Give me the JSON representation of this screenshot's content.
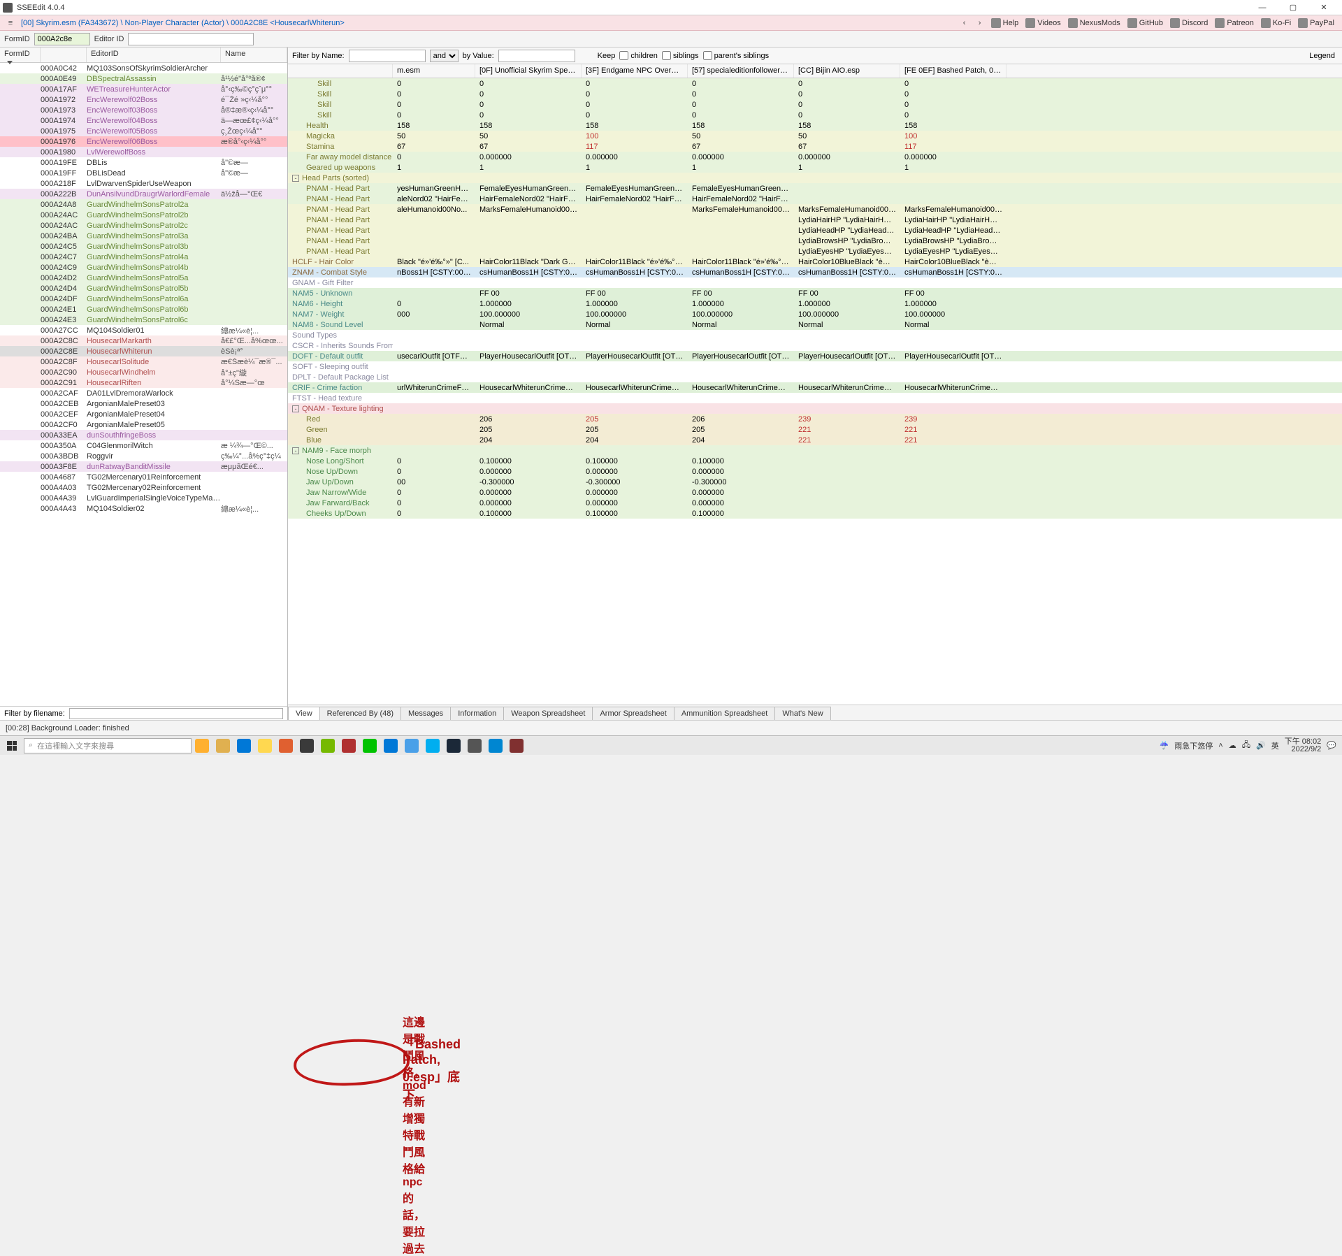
{
  "app": {
    "title": "SSEEdit 4.0.4"
  },
  "crumb": "[00] Skyrim.esm (FA343672) \\ Non-Player Character (Actor) \\ 000A2C8E <HousecarlWhiterun>",
  "toplinks": [
    "Help",
    "Videos",
    "NexusMods",
    "GitHub",
    "Discord",
    "Patreon",
    "Ko-Fi",
    "PayPal"
  ],
  "fidbar": {
    "formid_lbl": "FormID",
    "formid_val": "000A2c8e",
    "editorid_lbl": "Editor ID",
    "editorid_val": ""
  },
  "left_hdr": {
    "c1": "FormID",
    "c2": "",
    "c3": "EditorID",
    "c4": "Name"
  },
  "left_rows": [
    {
      "f": "000A0C42",
      "e": "MQ103SonsOfSkyrimSoldierArcher",
      "n": "",
      "cls": "c-plain"
    },
    {
      "f": "000A0E49",
      "e": "DBSpectralAssassin",
      "n": "å¹½é­\"å°ºå®¢",
      "cls": "c-green0"
    },
    {
      "f": "000A17AF",
      "e": "WETreasureHunterActor",
      "n": "å°‹ç‰©ç°çˆμ°°",
      "cls": "c-purple"
    },
    {
      "f": "000A1972",
      "e": "EncWerewolf02Boss",
      "n": "é¯Žé »ç‹¼å°°",
      "cls": "c-purple"
    },
    {
      "f": "000A1973",
      "e": "EncWerewolf03Boss",
      "n": "å®‡æ®‹ç‹¼å°°",
      "cls": "c-purple"
    },
    {
      "f": "000A1974",
      "e": "EncWerewolf04Boss",
      "n": "ä—æœ£¢ç‹¼å°°",
      "cls": "c-purple"
    },
    {
      "f": "000A1975",
      "e": "EncWerewolf05Boss",
      "n": "ç¸Žœç‹¼å°°",
      "cls": "c-purple"
    },
    {
      "f": "000A1976",
      "e": "EncWerewolf06Boss",
      "n": "æ®å°‹ç‹¼å°°",
      "cls": "c-purpleR hlbar"
    },
    {
      "f": "000A1980",
      "e": "LvlWerewolfBoss",
      "n": "",
      "cls": "c-purple"
    },
    {
      "f": "000A19FE",
      "e": "DBLis",
      "n": "å\"©æ—",
      "cls": "c-plain"
    },
    {
      "f": "000A19FF",
      "e": "DBLisDead",
      "n": "å\"©æ—",
      "cls": "c-plain"
    },
    {
      "f": "000A218F",
      "e": "LvlDwarvenSpiderUseWeapon",
      "n": "",
      "cls": "c-plain"
    },
    {
      "f": "000A222B",
      "e": "DunAnsilvundDraugrWarlordFemale",
      "n": "ä½žå—°Œ€",
      "cls": "c-purple"
    },
    {
      "f": "000A24A8",
      "e": "GuardWindhelmSonsPatrol2a",
      "n": "",
      "cls": "c-green0"
    },
    {
      "f": "000A24AC",
      "e": "GuardWindhelmSonsPatrol2b",
      "n": "",
      "cls": "c-green0"
    },
    {
      "f": "000A24AC",
      "e": "GuardWindhelmSonsPatrol2c",
      "n": "",
      "cls": "c-green0"
    },
    {
      "f": "000A24BA",
      "e": "GuardWindhelmSonsPatrol3a",
      "n": "",
      "cls": "c-green0"
    },
    {
      "f": "000A24C5",
      "e": "GuardWindhelmSonsPatrol3b",
      "n": "",
      "cls": "c-green0"
    },
    {
      "f": "000A24C7",
      "e": "GuardWindhelmSonsPatrol4a",
      "n": "",
      "cls": "c-green0"
    },
    {
      "f": "000A24C9",
      "e": "GuardWindhelmSonsPatrol4b",
      "n": "",
      "cls": "c-green0"
    },
    {
      "f": "000A24D2",
      "e": "GuardWindhelmSonsPatrol5a",
      "n": "",
      "cls": "c-green0"
    },
    {
      "f": "000A24D4",
      "e": "GuardWindhelmSonsPatrol5b",
      "n": "",
      "cls": "c-green0"
    },
    {
      "f": "000A24DF",
      "e": "GuardWindhelmSonsPatrol6a",
      "n": "",
      "cls": "c-green0"
    },
    {
      "f": "000A24E1",
      "e": "GuardWindhelmSonsPatrol6b",
      "n": "",
      "cls": "c-green0"
    },
    {
      "f": "000A24E3",
      "e": "GuardWindhelmSonsPatrol6c",
      "n": "",
      "cls": "c-green0"
    },
    {
      "f": "000A27CC",
      "e": "MQ104Soldier01",
      "n": "總æ¼«è¦...",
      "cls": "c-plain"
    },
    {
      "f": "000A2C8C",
      "e": "HousecarlMarkarth",
      "n": "å€£°Œ...å%œœ...",
      "cls": "c-red"
    },
    {
      "f": "000A2C8E",
      "e": "HousecarlWhiterun",
      "n": "èSè¡ª°",
      "cls": "c-red sel"
    },
    {
      "f": "000A2C8F",
      "e": "HousecarlSolitude",
      "n": "æ€Šæè¼¯æ®¯...",
      "cls": "c-red"
    },
    {
      "f": "000A2C90",
      "e": "HousecarlWindhelm",
      "n": "å°±ç\"縼",
      "cls": "c-red"
    },
    {
      "f": "000A2C91",
      "e": "HousecarlRiften",
      "n": "å°¼Sæ—°œ",
      "cls": "c-red"
    },
    {
      "f": "000A2CAF",
      "e": "DA01LvlDremoraWarlock",
      "n": "",
      "cls": "c-plain"
    },
    {
      "f": "000A2CEB",
      "e": "ArgonianMalePreset03",
      "n": "",
      "cls": "c-plain"
    },
    {
      "f": "000A2CEF",
      "e": "ArgonianMalePreset04",
      "n": "",
      "cls": "c-plain"
    },
    {
      "f": "000A2CF0",
      "e": "ArgonianMalePreset05",
      "n": "",
      "cls": "c-plain"
    },
    {
      "f": "000A33EA",
      "e": "dunSouthfringeBoss",
      "n": "",
      "cls": "c-purple"
    },
    {
      "f": "000A350A",
      "e": "C04GlenmorilWitch",
      "n": "æ ¼¾—°Œ©...",
      "cls": "c-plain"
    },
    {
      "f": "000A3BDB",
      "e": "Roggvir",
      "n": "ç‰¼°...å%ç°‡ç¼",
      "cls": "c-plain"
    },
    {
      "f": "000A3F8E",
      "e": "dunRatwayBanditMissile",
      "n": "æμμãŒé€...",
      "cls": "c-purple"
    },
    {
      "f": "000A4687",
      "e": "TG02Mercenary01Reinforcement",
      "n": "",
      "cls": "c-plain"
    },
    {
      "f": "000A4A03",
      "e": "TG02Mercenary02Reinforcement",
      "n": "",
      "cls": "c-plain"
    },
    {
      "f": "000A4A39",
      "e": "LvlGuardImperialSingleVoiceTypeMaleGuard",
      "n": "",
      "cls": "c-plain"
    },
    {
      "f": "000A4A43",
      "e": "MQ104Soldier02",
      "n": "總æ¼«è¦...",
      "cls": "c-plain"
    }
  ],
  "lfilter_lbl": "Filter by filename:",
  "rfilter": {
    "name_lbl": "Filter by Name:",
    "and": "and",
    "val_lbl": "by Value:",
    "keep": "Keep",
    "children": "children",
    "siblings": "siblings",
    "psib": "parent's siblings",
    "legend": "Legend"
  },
  "rhdr": [
    "",
    "m.esm",
    "[0F] Unofficial Skyrim Special E...",
    "[3F] Endgame NPC Overhaul.esp",
    "[57] specialeditionfollowers.esp",
    "[CC] Bijin AIO.esp",
    "[FE 0EF] Bashed Patch, 0.esp"
  ],
  "rrows": [
    {
      "n": "Skill",
      "i": 2,
      "bg": "bg-lg",
      "nc": "name-olive",
      "v": [
        "0",
        "0",
        "0",
        "0",
        "0",
        "0"
      ]
    },
    {
      "n": "Skill",
      "i": 2,
      "bg": "bg-lg",
      "nc": "name-olive",
      "v": [
        "0",
        "0",
        "0",
        "0",
        "0",
        "0"
      ]
    },
    {
      "n": "Skill",
      "i": 2,
      "bg": "bg-lg",
      "nc": "name-olive",
      "v": [
        "0",
        "0",
        "0",
        "0",
        "0",
        "0"
      ]
    },
    {
      "n": "Skill",
      "i": 2,
      "bg": "bg-lg",
      "nc": "name-olive",
      "v": [
        "0",
        "0",
        "0",
        "0",
        "0",
        "0"
      ]
    },
    {
      "n": "Health",
      "i": 1,
      "bg": "bg-lg",
      "nc": "name-olive",
      "v": [
        "158",
        "158",
        "158",
        "158",
        "158",
        "158"
      ]
    },
    {
      "n": "Magicka",
      "i": 1,
      "bg": "bg-yg",
      "nc": "name-olive",
      "v": [
        "50",
        "50",
        "100",
        "50",
        "50",
        "100"
      ],
      "hl": [
        2,
        5
      ]
    },
    {
      "n": "Stamina",
      "i": 1,
      "bg": "bg-yg",
      "nc": "name-olive",
      "v": [
        "67",
        "67",
        "117",
        "67",
        "67",
        "117"
      ],
      "hl": [
        2,
        5
      ]
    },
    {
      "n": "Far away model distance",
      "i": 1,
      "bg": "bg-lg",
      "nc": "name-olive",
      "v": [
        "0",
        "0.000000",
        "0.000000",
        "0.000000",
        "0.000000",
        "0.000000"
      ]
    },
    {
      "n": "Geared up weapons",
      "i": 1,
      "bg": "bg-lg",
      "nc": "name-olive",
      "v": [
        "1",
        "1",
        "1",
        "1",
        "1",
        "1"
      ]
    },
    {
      "n": "Head Parts (sorted)",
      "i": 0,
      "tw": "-",
      "bg": "bg-yg",
      "nc": "name-olive",
      "v": [
        "",
        "",
        "",
        "",
        "",
        ""
      ]
    },
    {
      "n": "PNAM - Head Part",
      "i": 1,
      "bg": "bg-lg",
      "nc": "name-olive",
      "v": [
        "yesHumanGreenHazel...",
        "FemaleEyesHumanGreenHazel...",
        "FemaleEyesHumanGreenHazel...",
        "FemaleEyesHumanGreenHazel...",
        "",
        ""
      ]
    },
    {
      "n": "PNAM - Head Part",
      "i": 1,
      "bg": "bg-lg",
      "nc": "name-olive",
      "v": [
        "aleNord02 \"HairFemal...",
        "HairFemaleNord02 \"HairFemal...",
        "HairFemaleNord02 \"HairFemal...",
        "HairFemaleNord02 \"HairFemal...",
        "",
        ""
      ]
    },
    {
      "n": "PNAM - Head Part",
      "i": 1,
      "bg": "bg-yg",
      "nc": "name-olive",
      "v": [
        "aleHumanoid00No...",
        "MarksFemaleHumanoid00No...",
        "",
        "MarksFemaleHumanoid00No...",
        "MarksFemaleHumanoid00No...",
        "MarksFemaleHumanoid00No..."
      ]
    },
    {
      "n": "PNAM - Head Part",
      "i": 1,
      "bg": "bg-yg",
      "nc": "name-olive",
      "v": [
        "",
        "",
        "",
        "",
        "LydiaHairHP \"LydiaHairHP\" [H...",
        "LydiaHairHP \"LydiaHairHP\" [H..."
      ]
    },
    {
      "n": "PNAM - Head Part",
      "i": 1,
      "bg": "bg-yg",
      "nc": "name-olive",
      "v": [
        "",
        "",
        "",
        "",
        "LydiaHeadHP \"LydiaHeadHP\" ...",
        "LydiaHeadHP \"LydiaHeadHP\" ..."
      ]
    },
    {
      "n": "PNAM - Head Part",
      "i": 1,
      "bg": "bg-yg",
      "nc": "name-olive",
      "v": [
        "",
        "",
        "",
        "",
        "LydiaBrowsHP \"LydiaBrowsHP...",
        "LydiaBrowsHP \"LydiaBrowsHP..."
      ]
    },
    {
      "n": "PNAM - Head Part",
      "i": 1,
      "bg": "bg-yg",
      "nc": "name-olive",
      "v": [
        "",
        "",
        "",
        "",
        "LydiaEyesHP \"LydiaEyesHP\" [H...",
        "LydiaEyesHP \"LydiaEyesHP\" [H..."
      ]
    },
    {
      "n": "HCLF - Hair Color",
      "i": 0,
      "bg": "bg-yg",
      "nc": "name-brown",
      "v": [
        "Black \"é»'é‰°»\" [C...",
        "HairColor11Black \"Dark Grey\" ...",
        "HairColor11Black \"é»'é‰°»\" [C...",
        "HairColor11Black \"é»'é‰°»\" [C...",
        "HairColor10BlueBlack \"è— é...",
        "HairColor10BlueBlack \"è— é..."
      ]
    },
    {
      "n": "ZNAM - Combat Style",
      "i": 0,
      "bg": "bg-blue",
      "nc": "name-brown",
      "v": [
        "nBoss1H [CSTY:0003D...",
        "csHumanBoss1H [CSTY:0003D...",
        "csHumanBoss1H [CSTY:0003D...",
        "csHumanBoss1H [CSTY:0003D...",
        "csHumanBoss1H [CSTY:0003D...",
        "csHumanBoss1H [CSTY:0003D..."
      ]
    },
    {
      "n": "GNAM - Gift Filter",
      "i": 0,
      "bg": "",
      "nc": "name-gray",
      "v": [
        "",
        "",
        "",
        "",
        "",
        ""
      ]
    },
    {
      "n": "NAM5 - Unknown",
      "i": 0,
      "bg": "bg-gr",
      "nc": "name-teal",
      "v": [
        "",
        "FF 00",
        "FF 00",
        "FF 00",
        "FF 00",
        "FF 00"
      ]
    },
    {
      "n": "NAM6 - Height",
      "i": 0,
      "bg": "bg-gr",
      "nc": "name-teal",
      "v": [
        "0",
        "1.000000",
        "1.000000",
        "1.000000",
        "1.000000",
        "1.000000"
      ]
    },
    {
      "n": "NAM7 - Weight",
      "i": 0,
      "bg": "bg-gr",
      "nc": "name-teal",
      "v": [
        "000",
        "100.000000",
        "100.000000",
        "100.000000",
        "100.000000",
        "100.000000"
      ]
    },
    {
      "n": "NAM8 - Sound Level",
      "i": 0,
      "bg": "bg-gr",
      "nc": "name-teal",
      "v": [
        "",
        "Normal",
        "Normal",
        "Normal",
        "Normal",
        "Normal"
      ]
    },
    {
      "n": "Sound Types",
      "i": 0,
      "bg": "",
      "nc": "name-gray",
      "v": [
        "",
        "",
        "",
        "",
        "",
        ""
      ]
    },
    {
      "n": "CSCR - Inherits Sounds From",
      "i": 0,
      "bg": "",
      "nc": "name-gray",
      "v": [
        "",
        "",
        "",
        "",
        "",
        ""
      ]
    },
    {
      "n": "DOFT - Default outfit",
      "i": 0,
      "bg": "bg-gr",
      "nc": "name-teal",
      "v": [
        "usecarlOutfit [OTFT:0...",
        "PlayerHousecarlOutfit [OTFT:0...",
        "PlayerHousecarlOutfit [OTFT:0...",
        "PlayerHousecarlOutfit [OTFT:0...",
        "PlayerHousecarlOutfit [OTFT:0...",
        "PlayerHousecarlOutfit [OTFT:0..."
      ]
    },
    {
      "n": "SOFT - Sleeping outfit",
      "i": 0,
      "bg": "",
      "nc": "name-gray",
      "v": [
        "",
        "",
        "",
        "",
        "",
        ""
      ]
    },
    {
      "n": "DPLT - Default Package List",
      "i": 0,
      "bg": "",
      "nc": "name-gray",
      "v": [
        "",
        "",
        "",
        "",
        "",
        ""
      ]
    },
    {
      "n": "CRIF - Crime faction",
      "i": 0,
      "bg": "bg-gr",
      "nc": "name-teal",
      "v": [
        "urlWhiterunCrimeFacti...",
        "HousecarlWhiterunCrimeFacti...",
        "HousecarlWhiterunCrimeFacti...",
        "HousecarlWhiterunCrimeFacti...",
        "HousecarlWhiterunCrimeFacti...",
        "HousecarlWhiterunCrimeFacti..."
      ]
    },
    {
      "n": "FTST - Head texture",
      "i": 0,
      "bg": "",
      "nc": "name-gray",
      "v": [
        "",
        "",
        "",
        "",
        "",
        ""
      ]
    },
    {
      "n": "QNAM - Texture lighting",
      "i": 0,
      "tw": "-",
      "bg": "bg-pink",
      "nc": "name-red",
      "v": [
        "",
        "",
        "",
        "",
        "",
        ""
      ]
    },
    {
      "n": "Red",
      "i": 1,
      "bg": "bg-tan",
      "nc": "name-olive",
      "v": [
        "",
        "206",
        "205",
        "206",
        "239",
        "239"
      ],
      "hlc": {
        "2": "val-red",
        "4": "val-red",
        "5": "val-red"
      }
    },
    {
      "n": "Green",
      "i": 1,
      "bg": "bg-tan",
      "nc": "name-olive",
      "v": [
        "",
        "205",
        "205",
        "205",
        "221",
        "221"
      ],
      "hlc": {
        "4": "val-red",
        "5": "val-red"
      }
    },
    {
      "n": "Blue",
      "i": 1,
      "bg": "bg-tan",
      "nc": "name-olive",
      "v": [
        "",
        "204",
        "204",
        "204",
        "221",
        "221"
      ],
      "hlc": {
        "4": "val-red",
        "5": "val-red"
      }
    },
    {
      "n": "NAM9 - Face morph",
      "i": 0,
      "tw": "-",
      "bg": "bg-lg",
      "nc": "name-green",
      "v": [
        "",
        "",
        "",
        "",
        "",
        ""
      ]
    },
    {
      "n": "Nose Long/Short",
      "i": 1,
      "bg": "bg-lg",
      "nc": "name-green",
      "v": [
        "0",
        "0.100000",
        "0.100000",
        "0.100000",
        "",
        ""
      ]
    },
    {
      "n": "Nose Up/Down",
      "i": 1,
      "bg": "bg-lg",
      "nc": "name-green",
      "v": [
        "0",
        "0.000000",
        "0.000000",
        "0.000000",
        "",
        ""
      ]
    },
    {
      "n": "Jaw Up/Down",
      "i": 1,
      "bg": "bg-lg",
      "nc": "name-green",
      "v": [
        "00",
        "-0.300000",
        "-0.300000",
        "-0.300000",
        "",
        ""
      ]
    },
    {
      "n": "Jaw Narrow/Wide",
      "i": 1,
      "bg": "bg-lg",
      "nc": "name-green",
      "v": [
        "0",
        "0.000000",
        "0.000000",
        "0.000000",
        "",
        ""
      ]
    },
    {
      "n": "Jaw Farward/Back",
      "i": 1,
      "bg": "bg-lg",
      "nc": "name-green",
      "v": [
        "0",
        "0.000000",
        "0.000000",
        "0.000000",
        "",
        ""
      ]
    },
    {
      "n": "Cheeks Up/Down",
      "i": 1,
      "bg": "bg-lg",
      "nc": "name-green",
      "v": [
        "0",
        "0.100000",
        "0.100000",
        "0.100000",
        "",
        ""
      ]
    }
  ],
  "rtabs": [
    "View",
    "Referenced By (48)",
    "Messages",
    "Information",
    "Weapon Spreadsheet",
    "Armor Spreadsheet",
    "Ammunition Spreadsheet",
    "What's New"
  ],
  "status": "[00:28] Background Loader: finished",
  "annot": {
    "t1": "這邊是戰鬥風格，mod有新增獨特戰鬥風格給npc的話，要拉過去",
    "t2": "「Bashed Patch, 0.esp」底下"
  },
  "taskbar": {
    "search_ph": "在這裡輸入文字來搜尋",
    "icons": [
      "#ffb030",
      "#e0b050",
      "#0078d7",
      "#ffd850",
      "#e06030",
      "#3a3a3a",
      "#76b900",
      "#b03030",
      "#00c300",
      "#0078d7",
      "#4aa0e8",
      "#00aef0",
      "#1b2838",
      "#555",
      "#0086d1",
      "#803030"
    ],
    "weather": "雨急下悠停",
    "ime": "英",
    "time": "下午 08:02",
    "date": "2022/9/2"
  }
}
